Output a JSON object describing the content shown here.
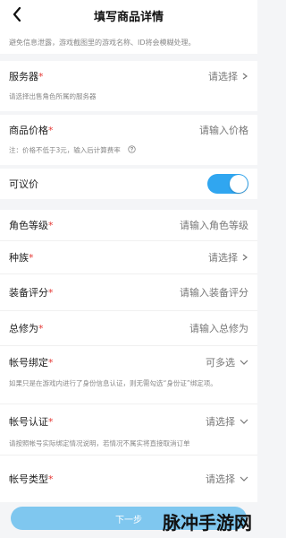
{
  "header": {
    "title": "填写商品详情",
    "back_icon": "chevron-left-icon"
  },
  "notice": "避免信息泄露，游戏截图里的游戏名称、ID将会模糊处理。",
  "fields": {
    "server": {
      "label": "服务器",
      "value": "请选择",
      "hint": "请选择出售角色所属的服务器"
    },
    "price": {
      "label": "商品价格",
      "placeholder": "请输入价格",
      "hint": "注：价格不低于3元，输入后计算费率"
    },
    "negotiable": {
      "label": "可议价",
      "on": true
    },
    "role_level": {
      "label": "角色等级",
      "placeholder": "请输入角色等级"
    },
    "race": {
      "label": "种族",
      "value": "请选择"
    },
    "equip_score": {
      "label": "装备评分",
      "placeholder": "请输入装备评分"
    },
    "total_cultivation": {
      "label": "总修为",
      "placeholder": "请输入总修为"
    },
    "account_bind": {
      "label": "帐号绑定",
      "value": "可多选",
      "hint": "如果只是在游戏内进行了身份信息认证，则无需勾选“身份证”绑定项。"
    },
    "account_verify": {
      "label": "帐号认证",
      "value": "请选择",
      "hint": "请按照帐号实际绑定情况说明，若情况不属实将直接取消订单"
    },
    "account_type": {
      "label": "帐号类型",
      "value": "请选择"
    }
  },
  "footer": {
    "next_label": "下一步",
    "watermark": "脉冲手游网"
  },
  "colors": {
    "accent": "#30a6f0",
    "required_star": "#e53935",
    "button": "#7fc7ef"
  }
}
